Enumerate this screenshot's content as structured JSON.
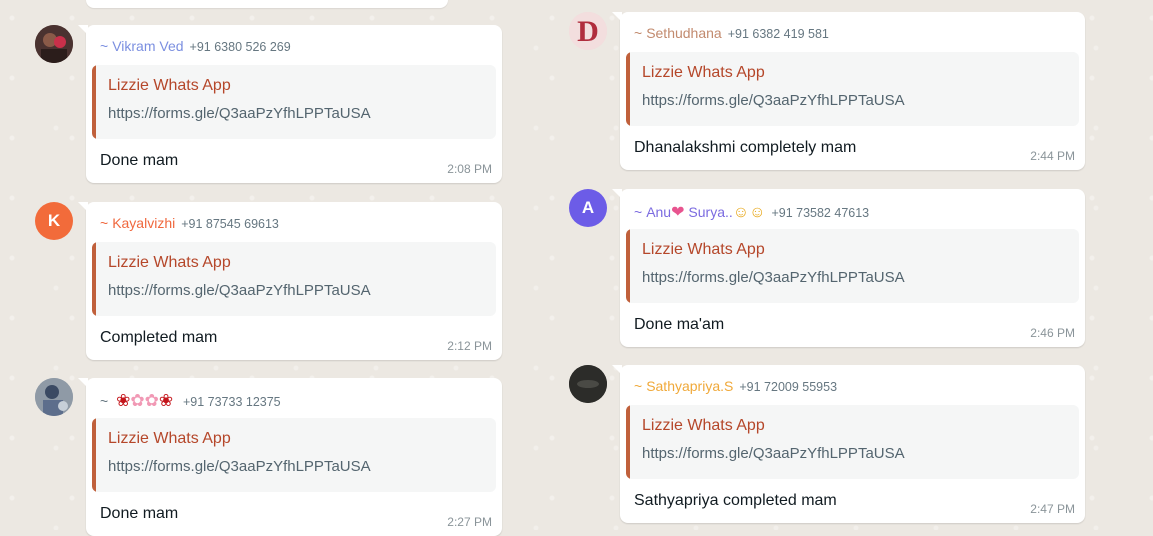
{
  "left": {
    "messages": [
      {
        "sender": "Vikram Ved",
        "sender_color": "#7b8fe0",
        "phone": "+91 6380 526 269",
        "avatar_type": "photo",
        "quote_title": "Lizzie Whats App",
        "quote_link": "https://forms.gle/Q3aaPzYfhLPPTaUSA",
        "text": "Done mam",
        "time": "2:08 PM"
      },
      {
        "sender": "Kayalvizhi",
        "sender_color": "#f0683e",
        "phone": "+91 87545 69613",
        "avatar_letter": "K",
        "avatar_color": "#f26b3a",
        "quote_title": "Lizzie Whats App",
        "quote_link": "https://forms.gle/Q3aaPzYfhLPPTaUSA",
        "text": "Completed mam",
        "time": "2:12 PM"
      },
      {
        "sender": "",
        "sender_color": "#667781",
        "phone": "+91 73733 12375",
        "avatar_type": "photo",
        "emoji_name": [
          "rose-emoji",
          "lotus-emoji",
          "lotus-emoji",
          "rose-emoji"
        ],
        "quote_title": "Lizzie Whats App",
        "quote_link": "https://forms.gle/Q3aaPzYfhLPPTaUSA",
        "text": "Done mam",
        "time": "2:27 PM"
      }
    ]
  },
  "right": {
    "messages": [
      {
        "sender": "Sethudhana",
        "sender_color": "#c28a6e",
        "phone": "+91 6382 419 581",
        "avatar_type": "photo",
        "quote_title": "Lizzie Whats App",
        "quote_link": "https://forms.gle/Q3aaPzYfhLPPTaUSA",
        "text": "Dhanalakshmi completely mam",
        "time": "2:44 PM"
      },
      {
        "sender": "Anu",
        "sender_suffix": "Surya..",
        "sender_color": "#7b6be0",
        "phone": "+91 73582 47613",
        "avatar_letter": "A",
        "avatar_color": "#6c5ce7",
        "quote_title": "Lizzie Whats App",
        "quote_link": "https://forms.gle/Q3aaPzYfhLPPTaUSA",
        "text": "Done ma'am",
        "time": "2:46 PM"
      },
      {
        "sender": "Sathyapriya.S",
        "sender_color": "#f0a93a",
        "phone": "+91 72009 55953",
        "avatar_type": "photo",
        "quote_title": "Lizzie Whats App",
        "quote_link": "https://forms.gle/Q3aaPzYfhLPPTaUSA",
        "text": "Sathyapriya completed mam",
        "time": "2:47 PM"
      }
    ]
  },
  "tilde": "~",
  "colors": {
    "quote_title": "#b5472a",
    "quote_bar": "#c0603b",
    "chat_background": "#ece8e2"
  }
}
